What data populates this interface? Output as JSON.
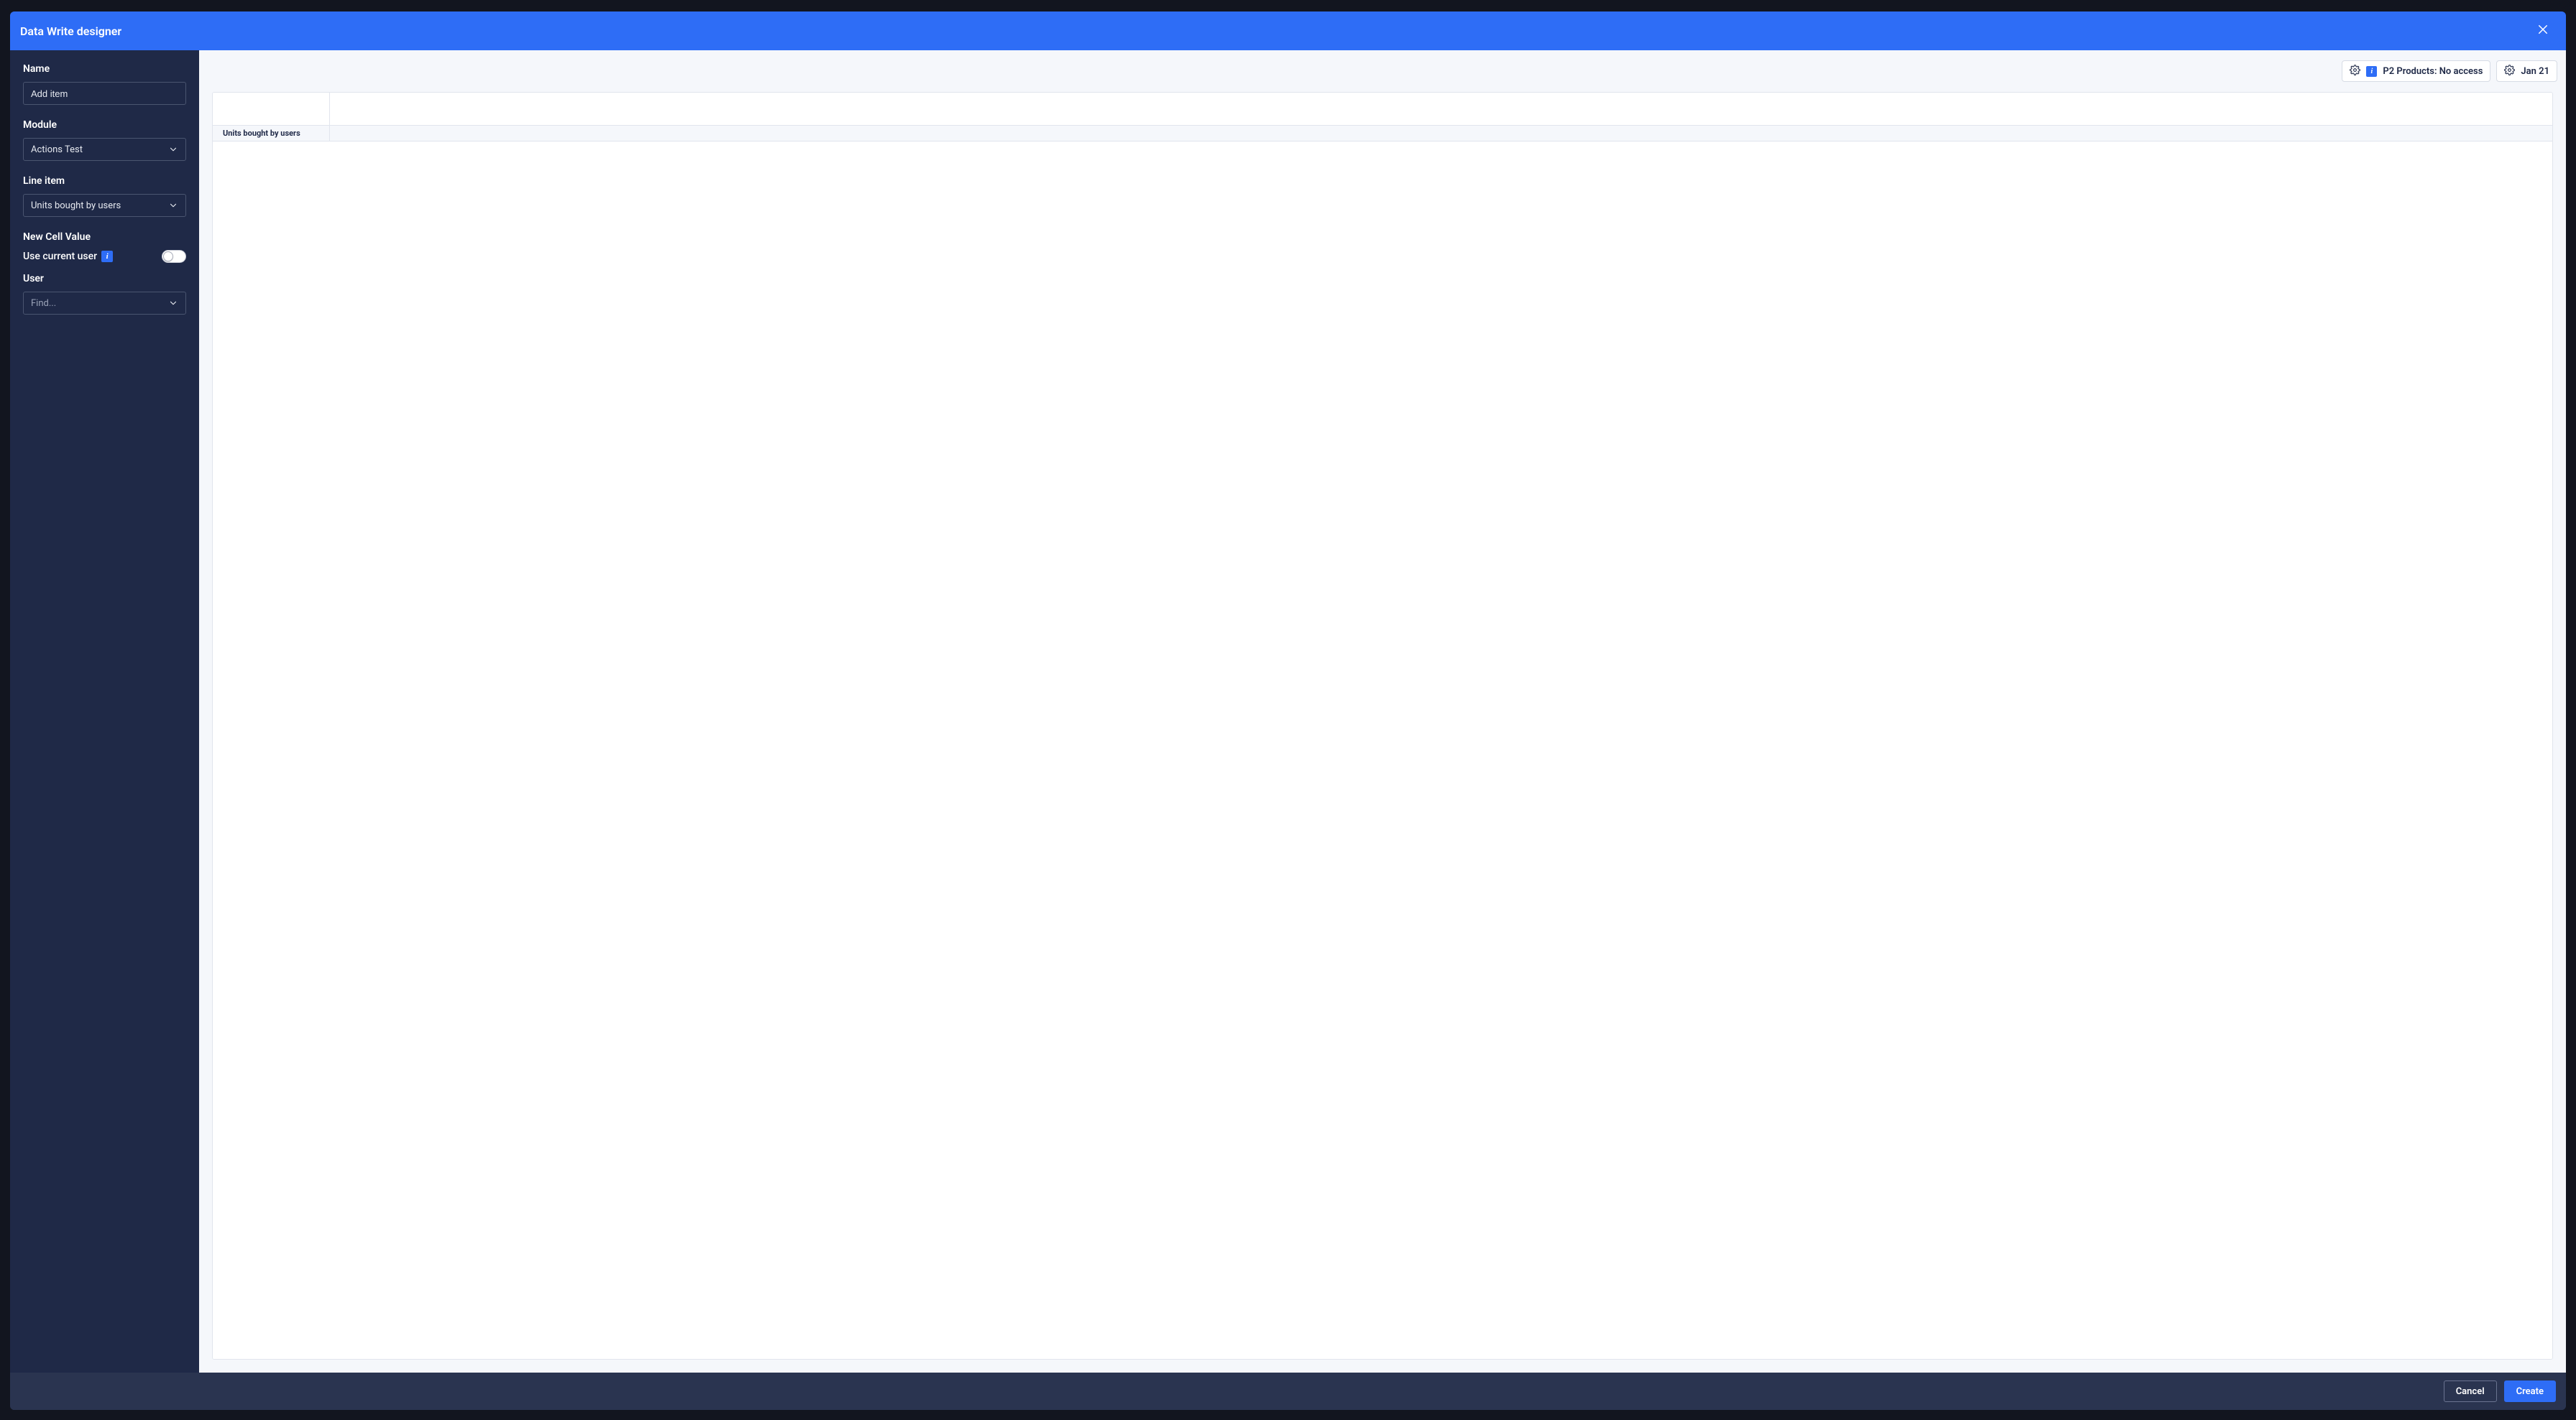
{
  "modal": {
    "title": "Data Write designer"
  },
  "sidebar": {
    "name_label": "Name",
    "name_value": "Add item",
    "module_label": "Module",
    "module_value": "Actions Test",
    "lineitem_label": "Line item",
    "lineitem_value": "Units bought by users",
    "newcell_label": "New Cell Value",
    "usecurrent_label": "Use current user",
    "user_label": "User",
    "user_placeholder": "Find..."
  },
  "context": {
    "access_label": "P2 Products: No access",
    "period_label": "Jan 21"
  },
  "grid": {
    "row_header": "Units bought by users"
  },
  "footer": {
    "cancel": "Cancel",
    "create": "Create"
  }
}
